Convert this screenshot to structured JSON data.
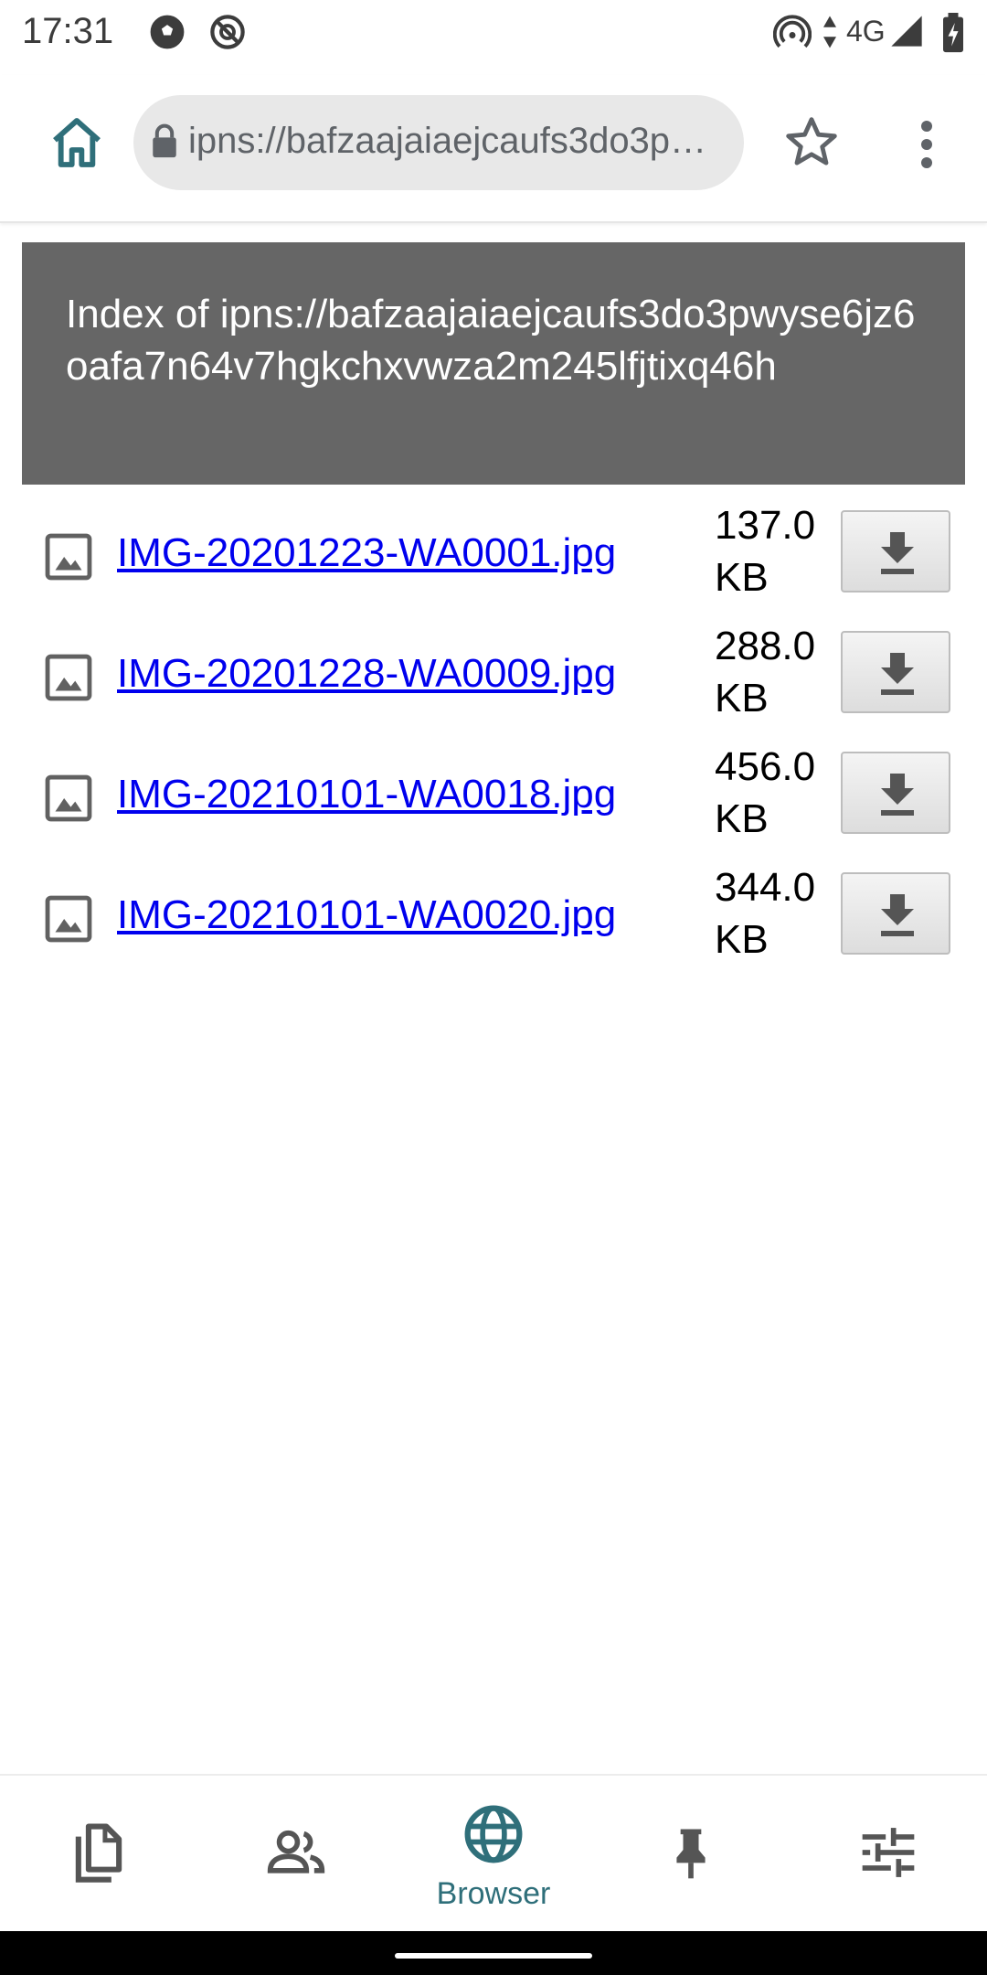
{
  "status_bar": {
    "time": "17:31",
    "network": "4G",
    "icons": [
      "soccer-ball-icon",
      "do-not-disturb-icon",
      "hotspot-icon",
      "data-arrows-icon",
      "signal-icon",
      "battery-charging-icon"
    ]
  },
  "toolbar": {
    "home_icon": "home-icon",
    "lock_icon": "lock-icon",
    "url": "ipns://bafzaajaiaejcaufs3do3p…",
    "bookmark_icon": "star-outline-icon",
    "menu_icon": "more-vert-icon"
  },
  "page": {
    "title": "Index of ipns://bafzaajaiaejcaufs3do3pwyse6jz6oafa7n64v7hgkchxvwza2m245lfjtixq46h",
    "files": [
      {
        "name": "IMG-20201223-WA0001.jpg",
        "size": "137.0 KB"
      },
      {
        "name": "IMG-20201228-WA0009.jpg",
        "size": "288.0 KB"
      },
      {
        "name": "IMG-20210101-WA0018.jpg",
        "size": "456.0 KB"
      },
      {
        "name": "IMG-20210101-WA0020.jpg",
        "size": "344.0 KB"
      }
    ]
  },
  "bottom_nav": {
    "items": [
      {
        "icon": "files-icon",
        "label": ""
      },
      {
        "icon": "people-icon",
        "label": ""
      },
      {
        "icon": "globe-icon",
        "label": "Browser",
        "active": true
      },
      {
        "icon": "pin-icon",
        "label": ""
      },
      {
        "icon": "settings-sliders-icon",
        "label": ""
      }
    ]
  },
  "colors": {
    "accent": "#2f6f7a",
    "header_bg": "#666666",
    "link": "#0000ee",
    "url_bar_bg": "#e8e8e8"
  }
}
